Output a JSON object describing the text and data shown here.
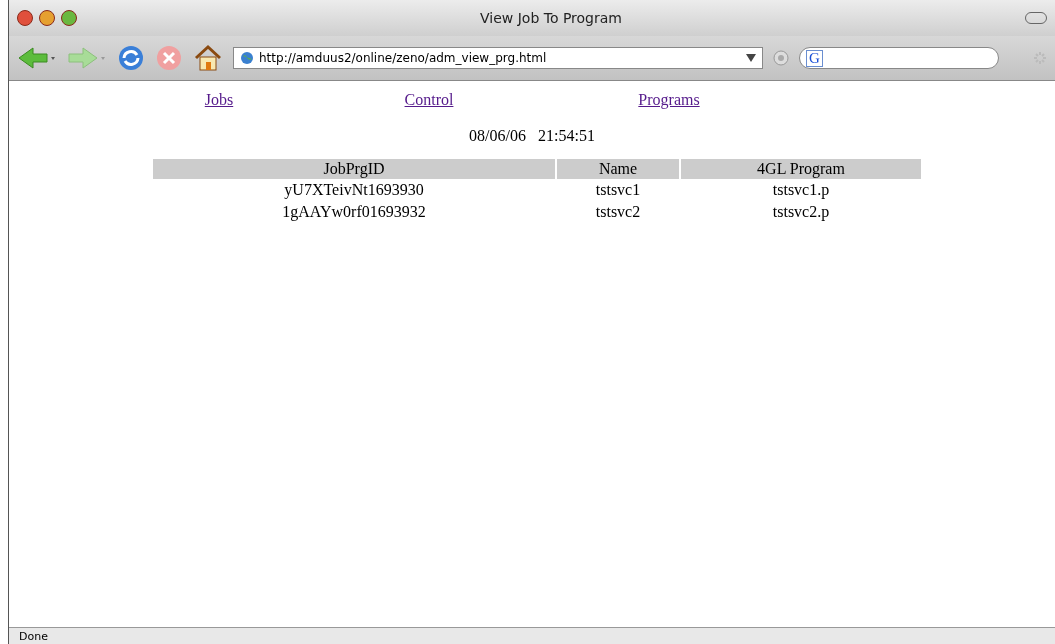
{
  "window": {
    "title": "View Job To Program"
  },
  "toolbar": {
    "address": "http://amduus2/online/zeno/adm_view_prg.html",
    "search_placeholder": "G"
  },
  "nav_links": [
    "Jobs",
    "Control",
    "Programs"
  ],
  "timestamp": {
    "date": "08/06/06",
    "time": "21:54:51"
  },
  "table": {
    "columns": [
      "JobPrgID",
      "Name",
      "4GL Program"
    ],
    "rows": [
      [
        "yU7XTeivNt1693930",
        "tstsvc1",
        "tstsvc1.p"
      ],
      [
        "1gAAYw0rf01693932",
        "tstsvc2",
        "tstsvc2.p"
      ]
    ]
  },
  "status_bar": "Done"
}
